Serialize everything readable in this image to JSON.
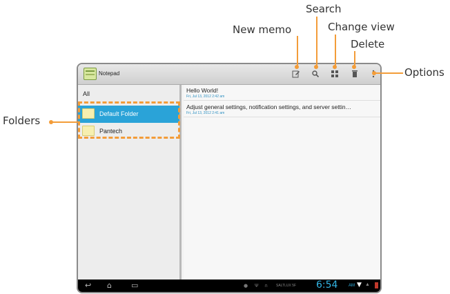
{
  "callouts": {
    "search": "Search",
    "change_view": "Change view",
    "new_memo": "New memo",
    "delete": "Delete",
    "options": "Options",
    "folders": "Folders"
  },
  "app": {
    "title": "Notepad"
  },
  "icons": {
    "new_memo": "new-memo-icon",
    "search": "search-icon",
    "change_view": "grid-view-icon",
    "delete": "trash-icon",
    "options": "overflow-menu-icon"
  },
  "sidebar": {
    "all_label": "All",
    "folders": [
      {
        "label": "Default Folder",
        "selected": true
      },
      {
        "label": "Pantech",
        "selected": false
      }
    ]
  },
  "memos": [
    {
      "title": "Hello World!",
      "date": "Fri, Jul 13, 2012 2:42 am"
    },
    {
      "title": "Adjust general settings, notification settings, and server settin…",
      "date": "Fri, Jul 13, 2012 2:41 am"
    }
  ],
  "statusbar": {
    "carrier": "SALTLUX 5F",
    "time": "6:54",
    "ampm": "AM"
  },
  "colors": {
    "callout": "#f39c38",
    "selection": "#2aa3d8",
    "time": "#33b5e5"
  }
}
